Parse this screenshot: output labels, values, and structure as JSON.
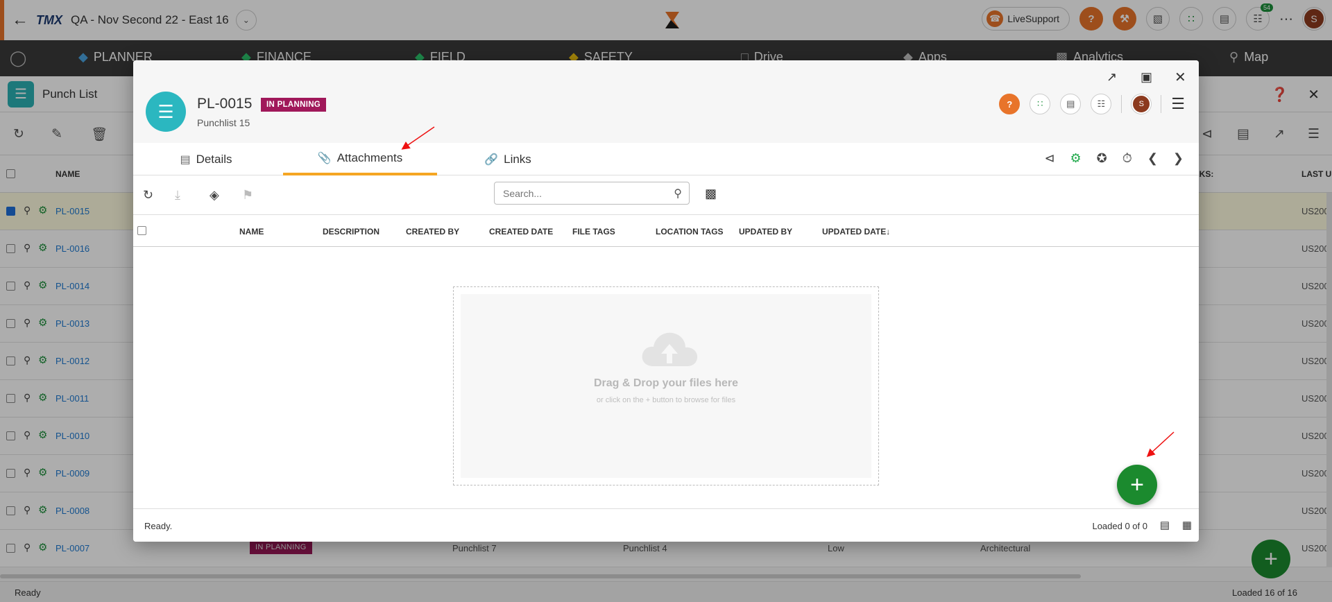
{
  "topbar": {
    "project_name": "QA - Nov Second 22 - East 16",
    "company_logo": "TMX",
    "live_support": "LiveSupport",
    "cart_badge": "54",
    "user_initial": "S"
  },
  "nav": {
    "items": [
      {
        "label": "PLANNER"
      },
      {
        "label": "FINANCE"
      },
      {
        "label": "FIELD"
      },
      {
        "label": "SAFETY"
      },
      {
        "label": "Drive"
      },
      {
        "label": "Apps"
      },
      {
        "label": "Analytics"
      },
      {
        "label": "Map"
      }
    ]
  },
  "page": {
    "title": "Punch List",
    "columns": {
      "name": "NAME",
      "remarks": "RKS:",
      "last": "LAST U"
    },
    "rows": [
      {
        "id": "PL-0015",
        "us": "US200"
      },
      {
        "id": "PL-0016",
        "us": "US200"
      },
      {
        "id": "PL-0014",
        "us": "US200"
      },
      {
        "id": "PL-0013",
        "us": "US200"
      },
      {
        "id": "PL-0012",
        "us": "US200"
      },
      {
        "id": "PL-0011",
        "us": "US200"
      },
      {
        "id": "PL-0010",
        "us": "US200"
      },
      {
        "id": "PL-0009",
        "us": "US200"
      },
      {
        "id": "PL-0008",
        "us": "US200"
      },
      {
        "id": "PL-0007",
        "us": "US200",
        "status": "IN PLANNING",
        "c1": "Punchlist 7",
        "c2": "Punchlist 4",
        "priority": "Low",
        "trade": "Architectural"
      }
    ],
    "status_left": "Ready",
    "status_right": "Loaded 16 of 16"
  },
  "dialog": {
    "record_id": "PL-0015",
    "status_badge": "IN PLANNING",
    "subtitle": "Punchlist 15",
    "user_initial": "S",
    "tabs": [
      {
        "label": "Details"
      },
      {
        "label": "Attachments"
      },
      {
        "label": "Links"
      }
    ],
    "search": {
      "placeholder": "Search...",
      "value": ""
    },
    "columns": {
      "name": "NAME",
      "description": "DESCRIPTION",
      "created_by": "CREATED BY",
      "created_date": "CREATED DATE",
      "file_tags": "FILE TAGS",
      "location_tags": "LOCATION TAGS",
      "updated_by": "UPDATED BY",
      "updated_date": "UPDATED DATE"
    },
    "drop": {
      "title": "Drag & Drop your files here",
      "subtitle": "or click on the + button to browse for files"
    },
    "status_left": "Ready.",
    "status_right": "Loaded 0 of 0"
  },
  "colors": {
    "accent": "#e8742a",
    "badge": "#a0185a",
    "fab": "#1b8a2e",
    "tab_underline": "#f5a623",
    "link": "#1e7ad1"
  }
}
